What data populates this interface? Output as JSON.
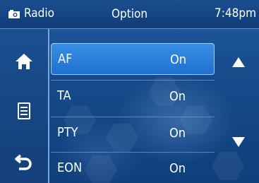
{
  "header": {
    "source_label": "Radio",
    "title": "Option",
    "time": "7:48pm"
  },
  "sidebar": {
    "icons": [
      "home-icon",
      "menu-list-icon",
      "back-icon"
    ]
  },
  "options": [
    {
      "name": "AF",
      "value": "On",
      "selected": true
    },
    {
      "name": "TA",
      "value": "On",
      "selected": false
    },
    {
      "name": "PTY",
      "value": "On",
      "selected": false
    },
    {
      "name": "EON",
      "value": "On",
      "selected": false
    }
  ],
  "scroll": {
    "icons": [
      "triangle-up-icon",
      "triangle-down-icon"
    ]
  },
  "colors": {
    "background": "#164a8a",
    "selection": "#2a80dc",
    "text": "#ffffff"
  }
}
